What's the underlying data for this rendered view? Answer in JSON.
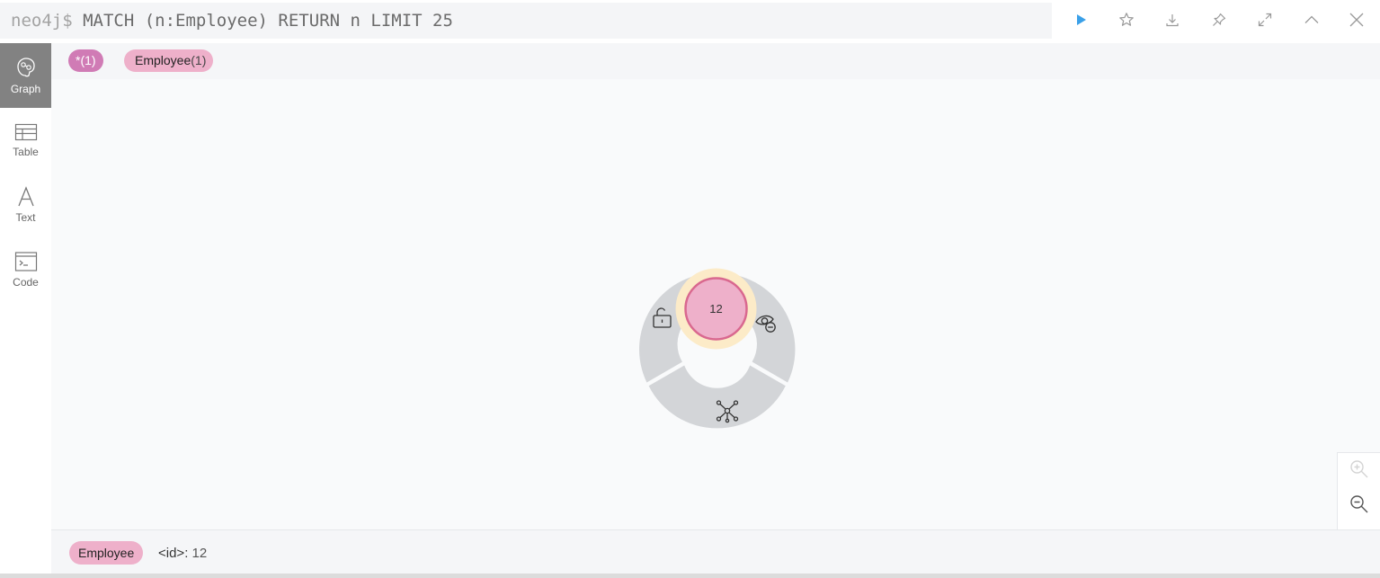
{
  "editor": {
    "prompt": "neo4j$",
    "query": "MATCH (n:Employee) RETURN n LIMIT 25"
  },
  "actions": {
    "run_icon": "play-icon",
    "favorite_icon": "star-icon",
    "download_icon": "download-icon",
    "pin_icon": "pin-icon",
    "fullscreen_icon": "expand-icon",
    "collapse_icon": "chevron-up-icon",
    "close_icon": "close-icon"
  },
  "sidebar": {
    "items": [
      {
        "label": "Graph",
        "icon": "graph-icon",
        "active": true
      },
      {
        "label": "Table",
        "icon": "table-icon",
        "active": false
      },
      {
        "label": "Text",
        "icon": "text-icon",
        "active": false
      },
      {
        "label": "Code",
        "icon": "code-icon",
        "active": false
      }
    ]
  },
  "labels_bar": {
    "all_label": "*",
    "all_count": "(1)",
    "employee_label": "Employee",
    "employee_count": "(1)"
  },
  "graph": {
    "node_caption": "12",
    "node_color": "#eeb0ca",
    "node_border": "#d9688f",
    "ring_color": "#fcebc8",
    "menu_color": "#d3d5d8",
    "menu_icons": [
      "unlock-icon",
      "hide-eye-icon",
      "expand-relationships-icon"
    ]
  },
  "zoom": {
    "zoom_in_icon": "zoom-in-icon",
    "zoom_out_icon": "zoom-out-icon"
  },
  "footer": {
    "label": "Employee",
    "property_key": "<id>:",
    "property_value": "12"
  },
  "colors": {
    "accent_run": "#3aa0e8",
    "sidebar_active": "#828282"
  }
}
